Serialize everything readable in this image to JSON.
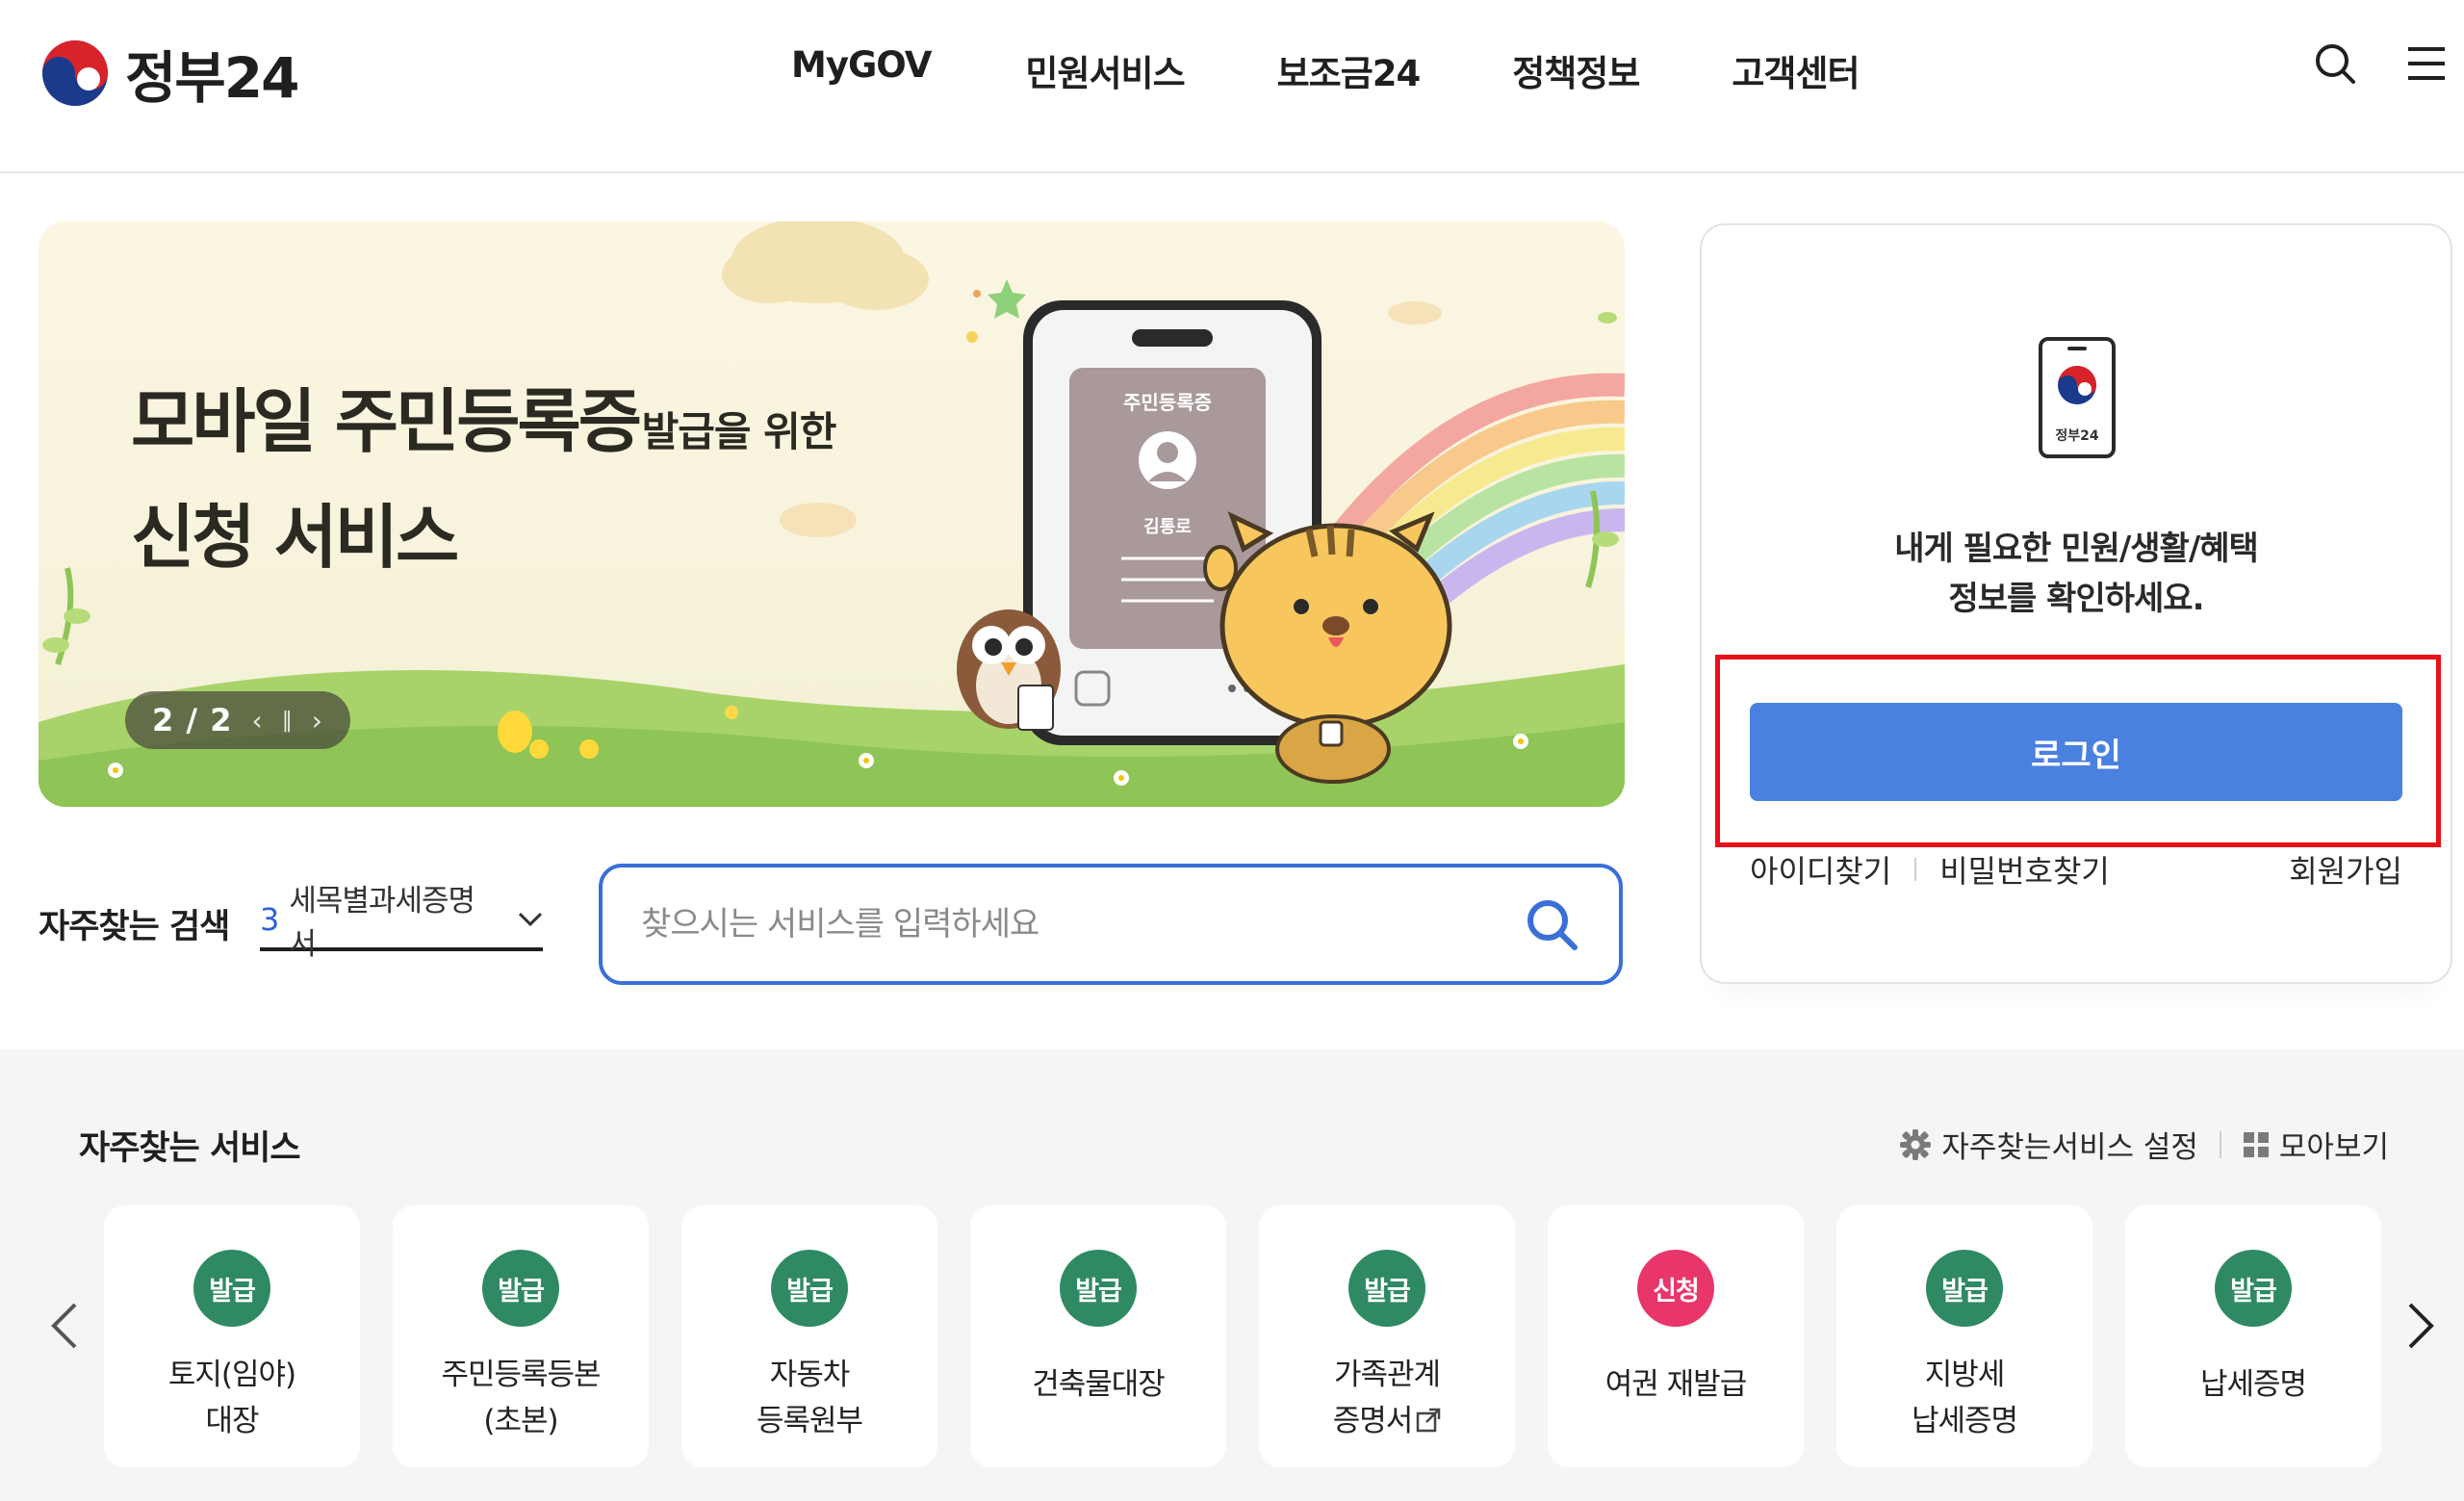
{
  "header": {
    "logo_text": "정부24",
    "nav": [
      "MyGOV",
      "민원서비스",
      "보조금24",
      "정책정보",
      "고객센터"
    ],
    "icons": [
      "search-icon",
      "menu-icon"
    ]
  },
  "banner": {
    "title_big_1": "모바일 주민등록증",
    "title_small": "발급을 위한",
    "title_big_2": "신청 서비스",
    "card_title": "주민등록증",
    "card_name": "김통로",
    "counter": "2 / 2",
    "controls": [
      "prev",
      "pause",
      "next"
    ]
  },
  "login": {
    "phone_logo_text": "정부24",
    "message_line1": "내게 필요한 민원/생활/혜택",
    "message_line2": "정보를 확인하세요.",
    "login_label": "로그인",
    "find_id": "아이디찾기",
    "find_pw": "비밀번호찾기",
    "signup": "회원가입",
    "highlight_color": "#e8101a"
  },
  "search": {
    "frequent_label": "자주찾는 검색",
    "frequent_rank": "3",
    "frequent_term": "세목별과세증명서",
    "placeholder": "찾으시는 서비스를 입력하세요",
    "value": ""
  },
  "services": {
    "title": "자주찾는 서비스",
    "settings_label": "자주찾는서비스 설정",
    "view_all_label": "모아보기",
    "items": [
      {
        "badge": "발급",
        "type": "issue",
        "line1": "토지(임야)",
        "line2": "대장"
      },
      {
        "badge": "발급",
        "type": "issue",
        "line1": "주민등록등본",
        "line2": "(초본)"
      },
      {
        "badge": "발급",
        "type": "issue",
        "line1": "자동차",
        "line2": "등록원부"
      },
      {
        "badge": "발급",
        "type": "issue",
        "line1": "건축물대장",
        "line2": ""
      },
      {
        "badge": "발급",
        "type": "issue",
        "line1": "가족관계",
        "line2": "증명서"
      },
      {
        "badge": "신청",
        "type": "apply",
        "line1": "여권 재발급",
        "line2": ""
      },
      {
        "badge": "발급",
        "type": "issue",
        "line1": "지방세",
        "line2": "납세증명"
      },
      {
        "badge": "발급",
        "type": "issue",
        "line1": "납세증명",
        "line2": ""
      }
    ]
  },
  "colors": {
    "accent_blue": "#4a80e0",
    "search_border": "#3a6fd8",
    "issue_badge": "#2f8a63",
    "apply_badge": "#e8356a"
  }
}
